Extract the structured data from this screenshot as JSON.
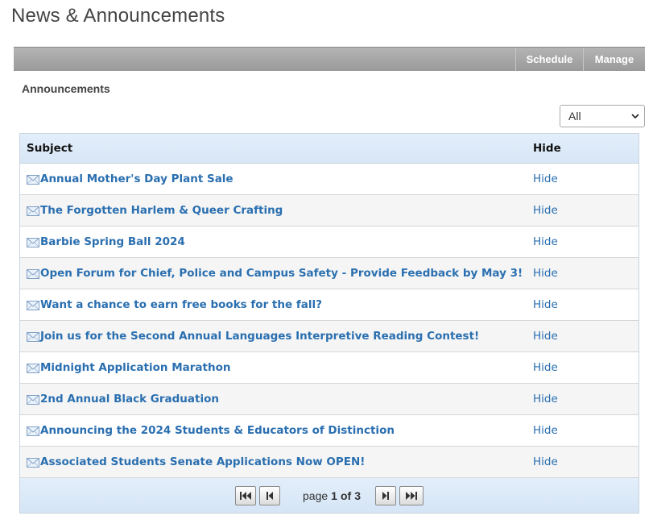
{
  "page": {
    "title": "News & Announcements"
  },
  "toolbar": {
    "schedule_label": "Schedule",
    "manage_label": "Manage"
  },
  "section": {
    "label": "Announcements"
  },
  "filter": {
    "selected": "All"
  },
  "grid": {
    "columns": {
      "subject": "Subject",
      "hide": "Hide"
    },
    "rows": [
      {
        "subject": "Annual Mother's Day Plant Sale",
        "action": "Hide"
      },
      {
        "subject": "The Forgotten Harlem & Queer Crafting",
        "action": "Hide"
      },
      {
        "subject": "Barbie Spring Ball 2024",
        "action": "Hide"
      },
      {
        "subject": "Open Forum for Chief, Police and Campus Safety - Provide Feedback by May 3!",
        "action": "Hide"
      },
      {
        "subject": "Want a chance to earn free books for the fall?",
        "action": "Hide"
      },
      {
        "subject": "Join us for the Second Annual Languages Interpretive Reading Contest!",
        "action": "Hide"
      },
      {
        "subject": "Midnight Application Marathon",
        "action": "Hide"
      },
      {
        "subject": "2nd Annual Black Graduation",
        "action": "Hide"
      },
      {
        "subject": "Announcing the 2024 Students & Educators of Distinction",
        "action": "Hide"
      },
      {
        "subject": "Associated Students Senate Applications Now OPEN!",
        "action": "Hide"
      }
    ]
  },
  "pager": {
    "page_word": "page",
    "current": "1",
    "of_word": "of",
    "total": "3"
  },
  "icons": {
    "row_icon": "envelope-icon",
    "first": "first-page-icon",
    "prev": "previous-page-icon",
    "next": "next-page-icon",
    "last": "last-page-icon"
  },
  "colors": {
    "link": "#2a6fb0",
    "toolbar": "#a8a8a8",
    "grid_header": "#dce9f7"
  }
}
